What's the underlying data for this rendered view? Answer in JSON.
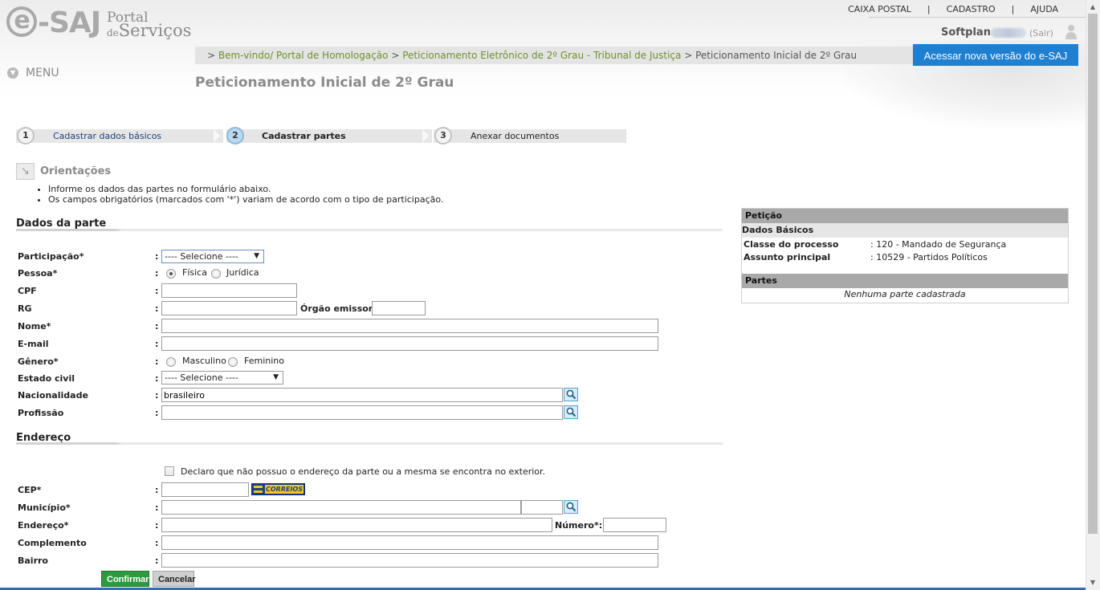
{
  "header": {
    "logo_main": "e-SAJ",
    "logo_line1": "Portal",
    "logo_line2_prefix": "de",
    "logo_line2_main": "Serviços",
    "top_links": [
      "CAIXA POSTAL",
      "CADASTRO",
      "AJUDA"
    ],
    "top_links_sep": "|",
    "user_name": "Softplan",
    "logout": "(Sair)",
    "new_version_button": "Acessar nova versão do e-SAJ",
    "menu_label": "MENU",
    "breadcrumb": {
      "prefix": ">",
      "items": [
        "Bem-vindo/ Portal de Homologação",
        "Peticionamento Eletrônico de 2º Grau - Tribunal de Justiça",
        "Peticionamento Inicial de 2º Grau"
      ],
      "sep": ">"
    },
    "page_title": "Peticionamento Inicial de 2º Grau"
  },
  "wizard": {
    "steps": [
      {
        "number": "1",
        "label": "Cadastrar dados básicos",
        "state": "done"
      },
      {
        "number": "2",
        "label": "Cadastrar partes",
        "state": "active"
      },
      {
        "number": "3",
        "label": "Anexar documentos",
        "state": "pending"
      }
    ]
  },
  "orientations": {
    "title": "Orientações",
    "items": [
      "Informe os dados das partes no formulário abaixo.",
      "Os campos obrigatórios (marcados com '*') variam de acordo com o tipo de participação."
    ]
  },
  "party_section": {
    "title": "Dados da parte",
    "colon": ":",
    "fields": {
      "participacao": {
        "label": "Participação*",
        "value": "---- Selecione ----"
      },
      "pessoa": {
        "label": "Pessoa*",
        "options": [
          "Física",
          "Jurídica"
        ],
        "selected": "Física"
      },
      "cpf": {
        "label": "CPF",
        "value": ""
      },
      "rg": {
        "label": "RG",
        "value": ""
      },
      "orgao_emissor": {
        "label": "Órgão emissor:",
        "value": ""
      },
      "nome": {
        "label": "Nome*",
        "value": ""
      },
      "email": {
        "label": "E-mail",
        "value": ""
      },
      "genero": {
        "label": "Gênero*",
        "options": [
          "Masculino",
          "Feminino"
        ],
        "selected": ""
      },
      "estado_civil": {
        "label": "Estado civil",
        "value": "---- Selecione ----"
      },
      "nacionalidade": {
        "label": "Nacionalidade",
        "value": "brasileiro"
      },
      "profissao": {
        "label": "Profissão",
        "value": ""
      }
    }
  },
  "address_section": {
    "title": "Endereço",
    "declaration": "Declaro que não possuo o endereço da parte ou a mesma se encontra no exterior.",
    "correios_label": "CORREIOS",
    "fields": {
      "cep": {
        "label": "CEP*",
        "value": ""
      },
      "municipio": {
        "label": "Município*",
        "value": "",
        "uf": ""
      },
      "endereco": {
        "label": "Endereço*",
        "value": ""
      },
      "numero": {
        "label": "Número*:",
        "value": ""
      },
      "complemento": {
        "label": "Complemento",
        "value": ""
      },
      "bairro": {
        "label": "Bairro",
        "value": ""
      }
    }
  },
  "buttons": {
    "confirm": "Confirmar",
    "cancel": "Cancelar"
  },
  "summary_panel": {
    "title": "Petição",
    "basic_title": "Dados Básicos",
    "rows": [
      {
        "key": "Classe do processo",
        "value": ": 120 - Mandado de Segurança"
      },
      {
        "key": "Assunto principal",
        "value": ": 10529 - Partidos Políticos"
      }
    ],
    "parties_title": "Partes",
    "parties_empty": "Nenhuma parte cadastrada"
  },
  "colors": {
    "link_green": "#6d8f2e",
    "primary_blue": "#1f7fd1",
    "confirm_green": "#2e9a3e"
  }
}
